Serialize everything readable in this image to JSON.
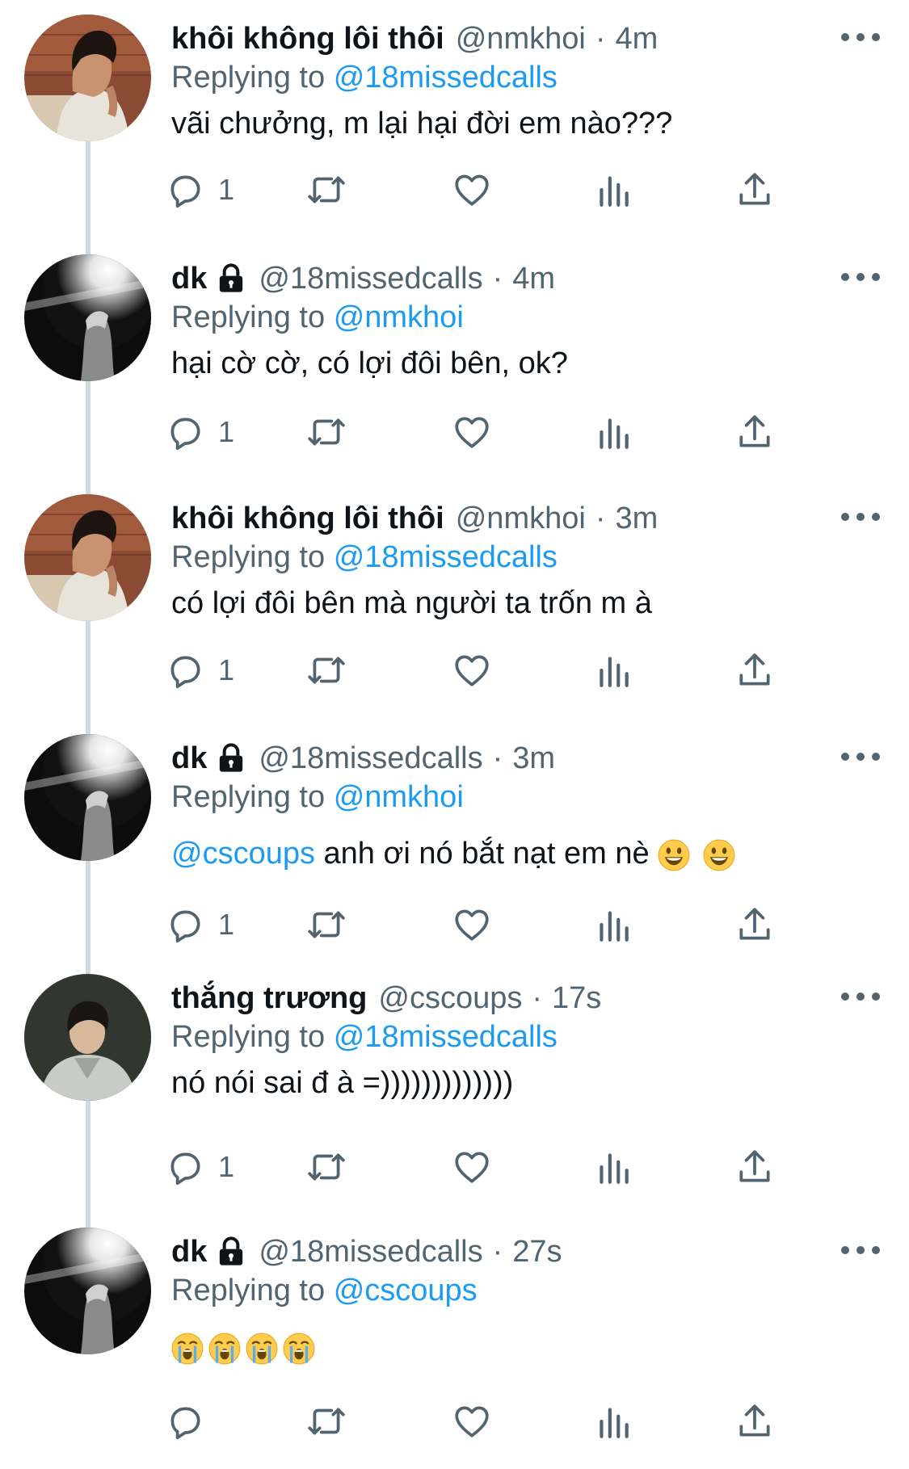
{
  "tweets": [
    {
      "name": "khôi không lôi thôi",
      "locked": false,
      "handle": "@nmkhoi",
      "time": "4m",
      "replying_label": "Replying to",
      "reply_to": "@18missedcalls",
      "text": "vãi chưởng, m lại hại đời em nào???",
      "reply_count": "1"
    },
    {
      "name": "dk",
      "locked": true,
      "handle": "@18missedcalls",
      "time": "4m",
      "replying_label": "Replying to",
      "reply_to": "@nmkhoi",
      "text": "hại cờ cờ, có lợi đôi bên, ok?",
      "reply_count": "1"
    },
    {
      "name": "khôi không lôi thôi",
      "locked": false,
      "handle": "@nmkhoi",
      "time": "3m",
      "replying_label": "Replying to",
      "reply_to": "@18missedcalls",
      "text": "có lợi đôi bên mà người ta trốn m à",
      "reply_count": "1"
    },
    {
      "name": "dk",
      "locked": true,
      "handle": "@18missedcalls",
      "time": "3m",
      "replying_label": "Replying to",
      "reply_to": "@nmkhoi",
      "mention": "@cscoups",
      "text": " anh ơi nó bắt nạt em nè",
      "emoji": [
        "smiley-icon",
        "smiley-icon"
      ],
      "reply_count": "1"
    },
    {
      "name": "thắng trương",
      "locked": false,
      "handle": "@cscoups",
      "time": "17s",
      "replying_label": "Replying to",
      "reply_to": "@18missedcalls",
      "text": "nó nói sai đ à =)))))))))))))",
      "reply_count": "1"
    },
    {
      "name": "dk",
      "locked": true,
      "handle": "@18missedcalls",
      "time": "27s",
      "replying_label": "Replying to",
      "reply_to": "@cscoups",
      "text": "",
      "emoji": [
        "crying-face-icon",
        "crying-face-icon",
        "crying-face-icon",
        "crying-face-icon"
      ],
      "reply_count": ""
    }
  ],
  "colors": {
    "text": "#0f1419",
    "secondary": "#536471",
    "link": "#1d9bf0",
    "thread_line": "#cfd9de"
  }
}
